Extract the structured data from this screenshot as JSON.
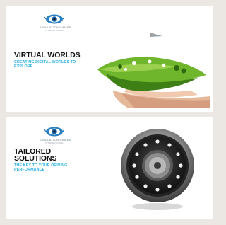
{
  "ads": [
    {
      "logo": {
        "name": "SIMULATION GAMES",
        "sub": "INTERNATIONAL"
      },
      "headline": "VIRTUAL WORLDS",
      "tagline": "CREATING DIGITAL WORLDS TO EXPLORE",
      "image": "hands-holding-virtual-landscape"
    },
    {
      "logo": {
        "name": "SIMULATION GAMES",
        "sub": "INTERNATIONAL"
      },
      "headline": "TAILORED SOLUTIONS",
      "tagline": "THE KEY TO YOUR DRIVING PERFORMANCE",
      "image": "steering-wheel-dial"
    }
  ],
  "colors": {
    "accent": "#2ab3e6",
    "background": "#ebe7e3",
    "card": "#ffffff"
  }
}
